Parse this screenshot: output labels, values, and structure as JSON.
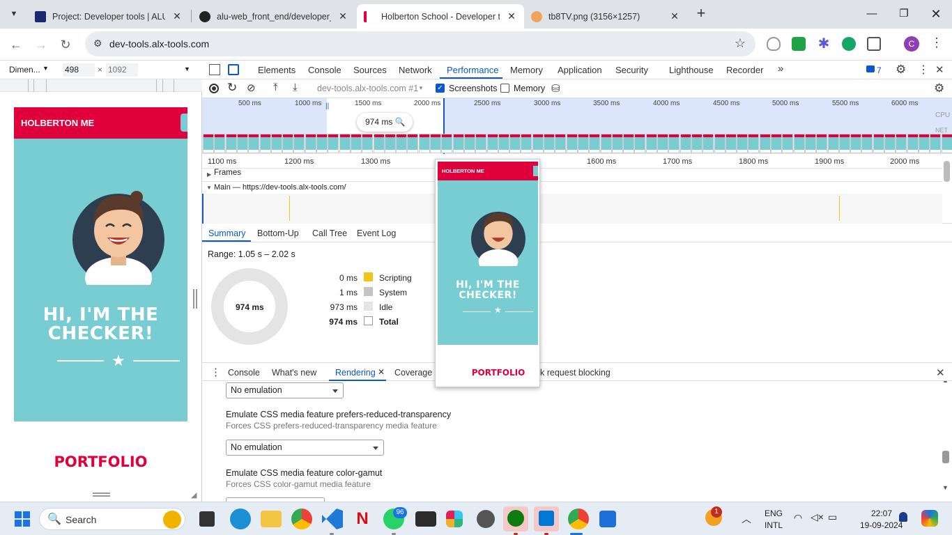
{
  "browser": {
    "tabs": [
      {
        "title": "Project: Developer tools | ALU I",
        "favicon": "alu-icon"
      },
      {
        "title": "alu-web_front_end/developer_t",
        "favicon": "github-icon"
      },
      {
        "title": "Holberton School - Developer t",
        "favicon": "holberton-icon"
      },
      {
        "title": "tb8TV.png (3156×1257)",
        "favicon": "image-icon"
      }
    ],
    "url": "dev-tools.alx-tools.com",
    "profile_initial": "C"
  },
  "device": {
    "preset": "Dimen...",
    "width": "498",
    "times": "×",
    "height": "1092"
  },
  "site": {
    "header": "HOLBERTON ME",
    "hero_line1": "HI, I'M THE",
    "hero_line2": "CHECKER!",
    "portfolio": "PORTFOLIO"
  },
  "devtools": {
    "tabs": [
      "Elements",
      "Console",
      "Sources",
      "Network",
      "Performance",
      "Memory",
      "Application",
      "Security",
      "Lighthouse",
      "Recorder"
    ],
    "more": "»",
    "issues_count": "7",
    "recording_target": "dev-tools.alx-tools.com #1",
    "screenshots_label": "Screenshots",
    "memory_label": "Memory",
    "overview_ticks": [
      "500 ms",
      "1000 ms",
      "1500 ms",
      "2000 ms",
      "2500 ms",
      "3000 ms",
      "3500 ms",
      "4000 ms",
      "4500 ms",
      "5000 ms",
      "5500 ms",
      "6000 ms"
    ],
    "cpu_label": "CPU",
    "net_label": "NET",
    "hover_time": "974 ms",
    "flame_ticks": [
      "1100 ms",
      "1200 ms",
      "1300 ms",
      "1600 ms",
      "1700 ms",
      "1800 ms",
      "1900 ms",
      "2000 ms"
    ],
    "frames_label": "Frames",
    "main_label": "Main — https://dev-tools.alx-tools.com/",
    "bottom_tabs": [
      "Summary",
      "Bottom-Up",
      "Call Tree",
      "Event Log"
    ],
    "range": "Range: 1.05 s – 2.02 s",
    "donut_center": "974 ms",
    "summary_rows": [
      {
        "value": "0 ms",
        "label": "Scripting",
        "color": "#f2c31b"
      },
      {
        "value": "1 ms",
        "label": "System",
        "color": "#c4c4c4"
      },
      {
        "value": "973 ms",
        "label": "Idle",
        "color": "#e4e4e4"
      },
      {
        "value": "974 ms",
        "label": "Total",
        "color": "#ffffff"
      }
    ],
    "drawer_tabs": [
      "Console",
      "What's new",
      "Rendering",
      "Coverage"
    ],
    "drawer_hidden_tab": "k request blocking",
    "rendering": {
      "select1": "No emulation",
      "label2": "Emulate CSS media feature prefers-reduced-transparency",
      "sub2": "Forces CSS prefers-reduced-transparency media feature",
      "select2": "No emulation",
      "label3": "Emulate CSS media feature color-gamut",
      "sub3": "Forces CSS color-gamut media feature"
    }
  },
  "preview": {
    "header": "HOLBERTON ME",
    "line1": "HI, I'M THE",
    "line2": "CHECKER!",
    "portfolio": "PORTFOLIO"
  },
  "taskbar": {
    "search": "Search",
    "whatsapp_badge": "96",
    "weather_badge": "1",
    "lang1": "ENG",
    "lang2": "INTL",
    "time": "22:07",
    "date": "19-09-2024"
  },
  "colors": {
    "accent": "#0b57d0",
    "holberton_red": "#e0003c",
    "hero_teal": "#77cdd2"
  }
}
